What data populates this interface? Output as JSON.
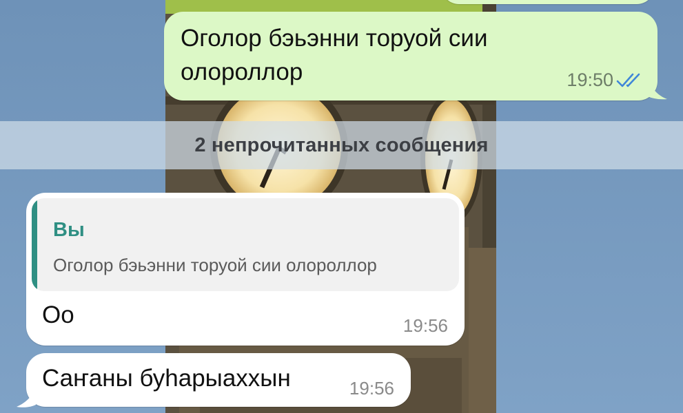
{
  "wallpaper": {
    "icon": "big-ben-wallpaper"
  },
  "colors": {
    "outgoing_bubble": "#dcf8c6",
    "incoming_bubble": "#ffffff",
    "quote_accent": "#2f8f83",
    "read_ticks": "#3f86d8"
  },
  "messages": {
    "outgoing": {
      "text": "Оголор бэьэнни торуой сии олороллор",
      "time": "19:50",
      "status_icon": "double-check-read-icon"
    },
    "unread_divider": "2 непрочитанных сообщения",
    "incoming": [
      {
        "reply_author": "Вы",
        "reply_text": "Оголор бэьэнни торуой сии олороллор",
        "text": "Оо",
        "time": "19:56"
      },
      {
        "text": "Саҥаны буһарыаххын",
        "time": "19:56"
      }
    ]
  }
}
